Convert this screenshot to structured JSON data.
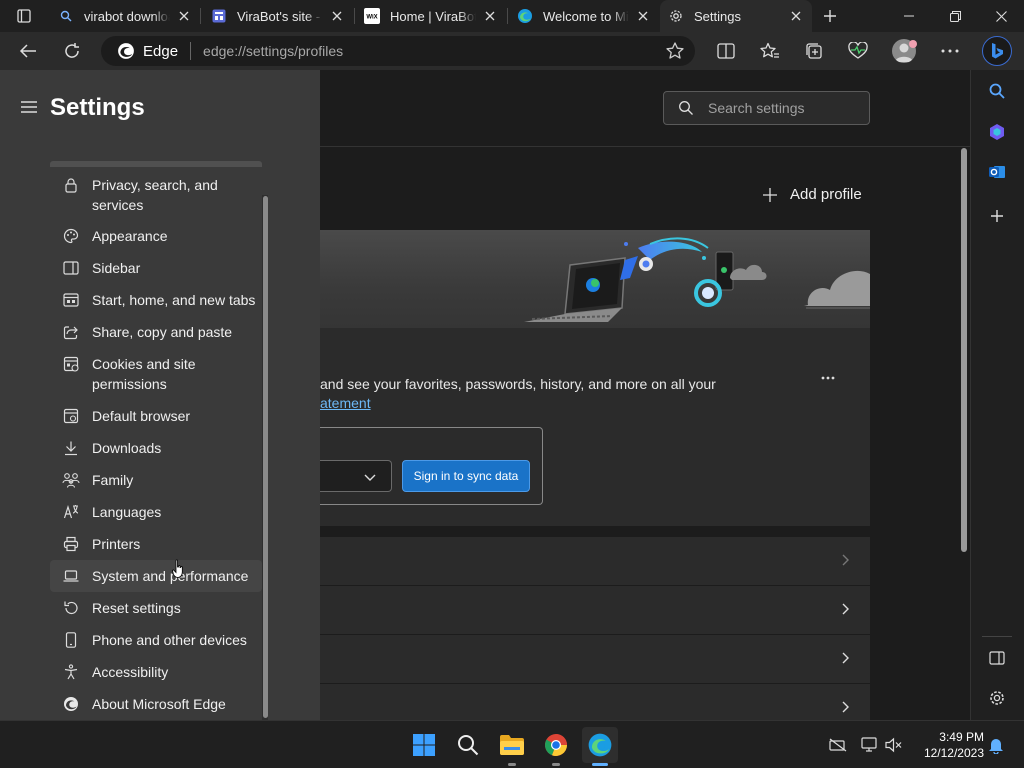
{
  "tabs": [
    {
      "title": "virabot download",
      "icon": "search-icon",
      "active": false
    },
    {
      "title": "ViraBot's site - D",
      "icon": "dashboard-icon",
      "active": false
    },
    {
      "title": "Home | ViraBot's",
      "icon": "wix-icon",
      "favicon_text": "WiX",
      "active": false
    },
    {
      "title": "Welcome to Mic",
      "icon": "edge-icon",
      "active": false
    },
    {
      "title": "Settings",
      "icon": "gear-icon",
      "active": true
    }
  ],
  "address_bar": {
    "site_label": "Edge",
    "url": "edge://settings/profiles"
  },
  "settings": {
    "title": "Settings",
    "search_placeholder": "Search settings",
    "nav_items": [
      {
        "label": "Privacy, search, and services",
        "icon": "lock-icon"
      },
      {
        "label": "Appearance",
        "icon": "palette-icon"
      },
      {
        "label": "Sidebar",
        "icon": "sidebar-icon"
      },
      {
        "label": "Start, home, and new tabs",
        "icon": "home-tabs-icon"
      },
      {
        "label": "Share, copy and paste",
        "icon": "share-icon"
      },
      {
        "label": "Cookies and site permissions",
        "icon": "cookie-icon"
      },
      {
        "label": "Default browser",
        "icon": "browser-icon"
      },
      {
        "label": "Downloads",
        "icon": "download-icon"
      },
      {
        "label": "Family",
        "icon": "family-icon"
      },
      {
        "label": "Languages",
        "icon": "language-icon"
      },
      {
        "label": "Printers",
        "icon": "printer-icon"
      },
      {
        "label": "System and performance",
        "icon": "laptop-icon"
      },
      {
        "label": "Reset settings",
        "icon": "reset-icon"
      },
      {
        "label": "Phone and other devices",
        "icon": "phone-icon"
      },
      {
        "label": "Accessibility",
        "icon": "accessibility-icon"
      },
      {
        "label": "About Microsoft Edge",
        "icon": "edge-icon"
      }
    ],
    "add_profile_label": "Add profile",
    "sync_text": "and see your favorites, passwords, history, and more on all your",
    "link_text": "atement",
    "sync_button_label": "Sign in to sync data"
  },
  "taskbar": {
    "time": "3:49 PM",
    "date": "12/12/2023"
  },
  "colors": {
    "accent": "#1a73c8",
    "link": "#6cb8f6",
    "nav_bg": "#3a3a3a",
    "card_bg": "#2b2b2b"
  }
}
